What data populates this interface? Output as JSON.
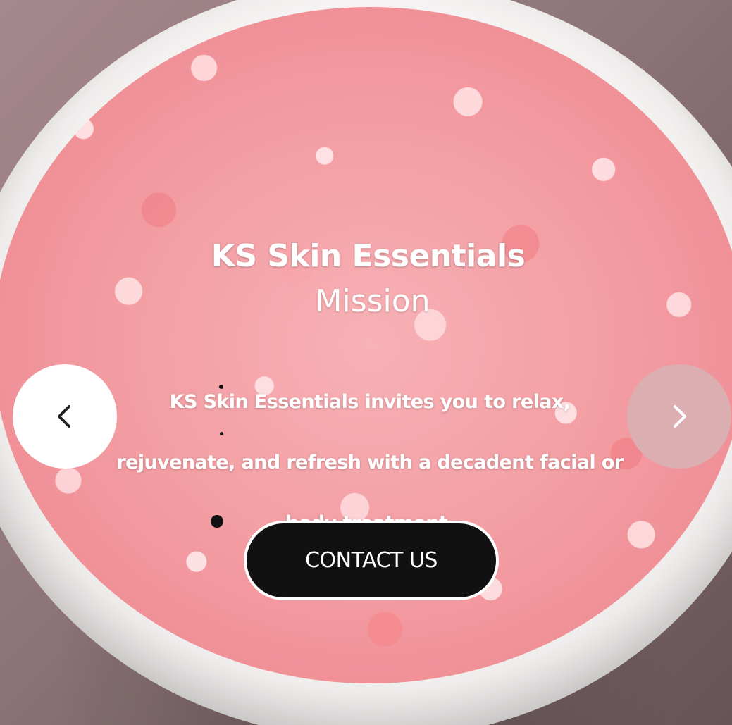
{
  "hero": {
    "brand": "KS Skin Essentials",
    "subtitle": "Mission",
    "description": "KS Skin Essentials invites you to relax, rejuvenate, and refresh with a decadent facial or body treatment.",
    "cta_label": "CONTACT US"
  },
  "carousel": {
    "prev_icon": "chevron-left-icon",
    "next_icon": "chevron-right-icon"
  },
  "colors": {
    "cta_background": "#111111",
    "cta_text": "#ffffff",
    "prev_button": "#ffffff",
    "next_button": "#dbaeb2",
    "salt_pink": "#f2949a"
  }
}
